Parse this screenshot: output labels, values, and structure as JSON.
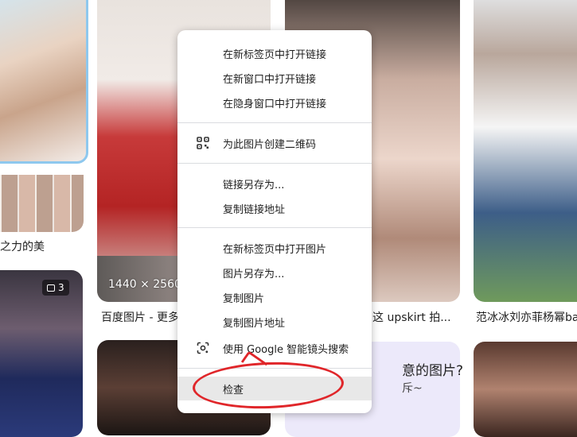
{
  "captions": {
    "a": "之力的美",
    "b": "百度图片 - 更多",
    "c": "这 upskirt 拍...",
    "d": "范冰冰刘亦菲杨幂ba"
  },
  "overlay": {
    "dims": "1440 × 2560",
    "badge_count": "3"
  },
  "promo": {
    "title": "意的图片?",
    "sub": "斥~"
  },
  "menu": {
    "open_link_new_tab": "在新标签页中打开链接",
    "open_link_new_window": "在新窗口中打开链接",
    "open_link_incognito": "在隐身窗口中打开链接",
    "create_qr": "为此图片创建二维码",
    "save_link_as": "链接另存为...",
    "copy_link": "复制链接地址",
    "open_image_new_tab": "在新标签页中打开图片",
    "save_image_as": "图片另存为...",
    "copy_image": "复制图片",
    "copy_image_address": "复制图片地址",
    "google_lens": "使用 Google 智能镜头搜索",
    "inspect": "检查"
  },
  "colors": {
    "annotation": "#e0262a",
    "menu_bg": "#ffffff",
    "separator": "#dadce0"
  }
}
